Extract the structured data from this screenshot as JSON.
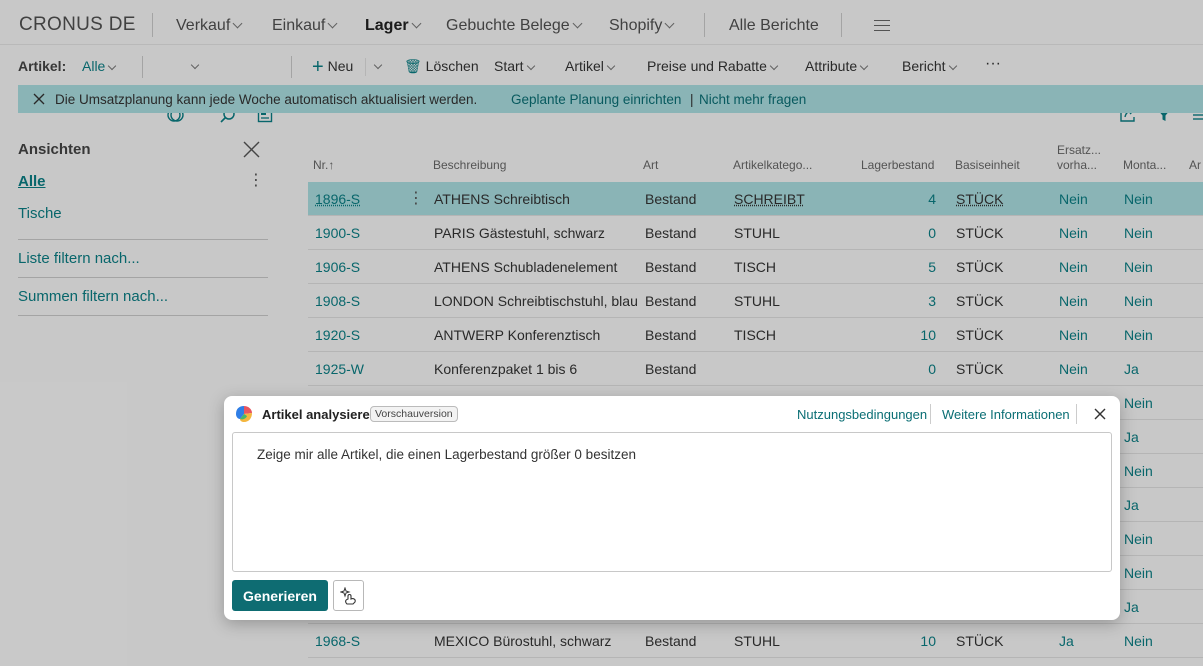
{
  "app": {
    "company": "CRONUS DE"
  },
  "topnav": {
    "items": [
      {
        "label": "Verkauf"
      },
      {
        "label": "Einkauf"
      },
      {
        "label": "Lager"
      },
      {
        "label": "Gebuchte Belege"
      },
      {
        "label": "Shopify"
      }
    ],
    "all_reports": "Alle Berichte"
  },
  "actionbar": {
    "page_label": "Artikel:",
    "filter_value": "Alle",
    "new": "Neu",
    "delete": "Löschen",
    "start": "Start",
    "artikel": "Artikel",
    "prices": "Preise und Rabatte",
    "attributes": "Attribute",
    "report": "Bericht",
    "more": "···"
  },
  "banner": {
    "text": "Die Umsatzplanung kann jede Woche automatisch aktualisiert werden.",
    "link1": "Geplante Planung einrichten",
    "sep": "|",
    "link2": "Nicht mehr fragen"
  },
  "views": {
    "title": "Ansichten",
    "items": [
      "Alle",
      "Tische"
    ],
    "filter_list": "Liste filtern nach...",
    "filter_totals": "Summen filtern nach..."
  },
  "table": {
    "headers": {
      "nr": "Nr.",
      "sort": "↑",
      "desc": "Beschreibung",
      "art": "Art",
      "cat": "Artikelkatego...",
      "stock": "Lagerbestand",
      "unit": "Basiseinheit",
      "subst1": "Ersatz...",
      "subst2": "vorha...",
      "mont": "Monta...",
      "extra": "Ar"
    },
    "rows": [
      {
        "nr": "1896-S",
        "desc": "ATHENS Schreibtisch",
        "art": "Bestand",
        "cat": "SCHREIBT",
        "stock": "4",
        "unit": "STÜCK",
        "subst": "Nein",
        "mont": "Nein"
      },
      {
        "nr": "1900-S",
        "desc": "PARIS Gästestuhl, schwarz",
        "art": "Bestand",
        "cat": "STUHL",
        "stock": "0",
        "unit": "STÜCK",
        "subst": "Nein",
        "mont": "Nein"
      },
      {
        "nr": "1906-S",
        "desc": "ATHENS Schubladenelement",
        "art": "Bestand",
        "cat": "TISCH",
        "stock": "5",
        "unit": "STÜCK",
        "subst": "Nein",
        "mont": "Nein"
      },
      {
        "nr": "1908-S",
        "desc": "LONDON Schreibtischstuhl, blau",
        "art": "Bestand",
        "cat": "STUHL",
        "stock": "3",
        "unit": "STÜCK",
        "subst": "Nein",
        "mont": "Nein"
      },
      {
        "nr": "1920-S",
        "desc": "ANTWERP Konferenztisch",
        "art": "Bestand",
        "cat": "TISCH",
        "stock": "10",
        "unit": "STÜCK",
        "subst": "Nein",
        "mont": "Nein"
      },
      {
        "nr": "1925-W",
        "desc": "Konferenzpaket 1 bis 6",
        "art": "Bestand",
        "cat": "",
        "stock": "0",
        "unit": "STÜCK",
        "subst": "Nein",
        "mont": "Ja"
      }
    ],
    "hidden_mont": [
      "Nein",
      "Ja",
      "Nein",
      "Ja",
      "Nein",
      "Nein",
      "Ja"
    ],
    "last_row": {
      "nr": "1968-S",
      "desc": "MEXICO Bürostuhl, schwarz",
      "art": "Bestand",
      "cat": "STUHL",
      "stock": "10",
      "unit": "STÜCK",
      "subst": "Ja",
      "mont": "Nein"
    }
  },
  "dialog": {
    "title": "Artikel analysieren",
    "badge": "Vorschauversion",
    "terms": "Nutzungsbedingungen",
    "more_info": "Weitere Informationen",
    "prompt": "Zeige mir alle Artikel, die einen Lagerbestand größer 0 besitzen",
    "generate": "Generieren"
  },
  "colors": {
    "accent": "#0a7d83",
    "selected_row": "#a9dcde",
    "button": "#0e6c72"
  }
}
